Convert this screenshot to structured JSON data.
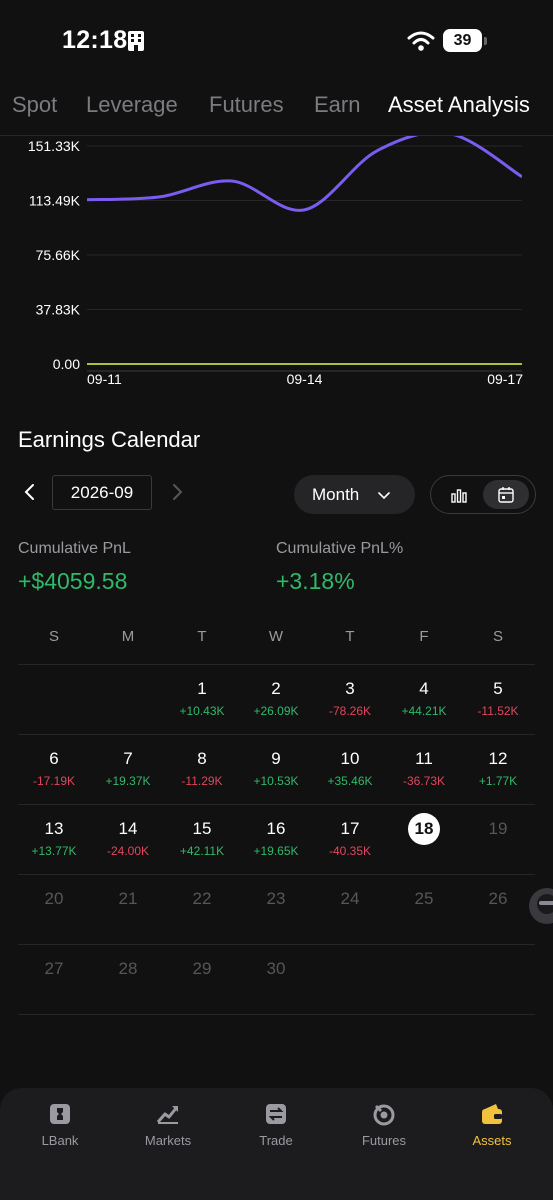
{
  "status": {
    "time": "12:18",
    "battery": "39"
  },
  "tabs": [
    {
      "label": "Spot",
      "active": false
    },
    {
      "label": "Leverage",
      "active": false
    },
    {
      "label": "Futures",
      "active": false
    },
    {
      "label": "Earn",
      "active": false
    },
    {
      "label": "Asset Analysis",
      "active": true
    }
  ],
  "chart_data": {
    "type": "line",
    "y_ticks": [
      "151.33K",
      "113.49K",
      "75.66K",
      "37.83K",
      "0.00"
    ],
    "x_ticks": [
      "09-11",
      "09-14",
      "09-17"
    ],
    "ylim": [
      0,
      151330
    ],
    "x": [
      "09-11",
      "09-12",
      "09-13",
      "09-14",
      "09-15",
      "09-16",
      "09-17"
    ],
    "series": [
      {
        "values": [
          114000,
          116000,
          127000,
          107000,
          148000,
          160000,
          130000
        ],
        "color": "#7b5cf0"
      },
      {
        "values": [
          0,
          0,
          0,
          0,
          0,
          0,
          0
        ],
        "color": "#a8c23a"
      }
    ]
  },
  "calendar": {
    "title": "Earnings Calendar",
    "month": "2026-09",
    "period": "Month",
    "cumulative_pnl_label": "Cumulative PnL",
    "cumulative_pnl_value": "+$4059.58",
    "cumulative_pnl_pct_label": "Cumulative PnL%",
    "cumulative_pnl_pct_value": "+3.18%",
    "weekdays": [
      "S",
      "M",
      "T",
      "W",
      "T",
      "F",
      "S"
    ],
    "days": [
      {
        "day": "1",
        "pnl": "+10.43K"
      },
      {
        "day": "2",
        "pnl": "+26.09K"
      },
      {
        "day": "3",
        "pnl": "-78.26K"
      },
      {
        "day": "4",
        "pnl": "+44.21K"
      },
      {
        "day": "5",
        "pnl": "-11.52K"
      },
      {
        "day": "6",
        "pnl": "-17.19K"
      },
      {
        "day": "7",
        "pnl": "+19.37K"
      },
      {
        "day": "8",
        "pnl": "-11.29K"
      },
      {
        "day": "9",
        "pnl": "+10.53K"
      },
      {
        "day": "10",
        "pnl": "+35.46K"
      },
      {
        "day": "11",
        "pnl": "-36.73K"
      },
      {
        "day": "12",
        "pnl": "+1.77K"
      },
      {
        "day": "13",
        "pnl": "+13.77K"
      },
      {
        "day": "14",
        "pnl": "-24.00K"
      },
      {
        "day": "15",
        "pnl": "+42.11K"
      },
      {
        "day": "16",
        "pnl": "+19.65K"
      },
      {
        "day": "17",
        "pnl": "-40.35K"
      },
      {
        "day": "18",
        "pnl": "",
        "today": true
      },
      {
        "day": "19",
        "pnl": ""
      },
      {
        "day": "20",
        "pnl": ""
      },
      {
        "day": "21",
        "pnl": ""
      },
      {
        "day": "22",
        "pnl": ""
      },
      {
        "day": "23",
        "pnl": ""
      },
      {
        "day": "24",
        "pnl": ""
      },
      {
        "day": "25",
        "pnl": ""
      },
      {
        "day": "26",
        "pnl": ""
      },
      {
        "day": "27",
        "pnl": ""
      },
      {
        "day": "28",
        "pnl": ""
      },
      {
        "day": "29",
        "pnl": ""
      },
      {
        "day": "30",
        "pnl": ""
      }
    ]
  },
  "nav": [
    {
      "label": "LBank",
      "icon": "lbank-logo-icon",
      "active": false
    },
    {
      "label": "Markets",
      "icon": "markets-chart-icon",
      "active": false
    },
    {
      "label": "Trade",
      "icon": "trade-swap-icon",
      "active": false
    },
    {
      "label": "Futures",
      "icon": "futures-icon",
      "active": false
    },
    {
      "label": "Assets",
      "icon": "wallet-icon",
      "active": true
    }
  ],
  "colors": {
    "positive": "#2fba69",
    "negative": "#e0465e",
    "accent": "#f3c23c",
    "line": "#7b5cf0"
  }
}
